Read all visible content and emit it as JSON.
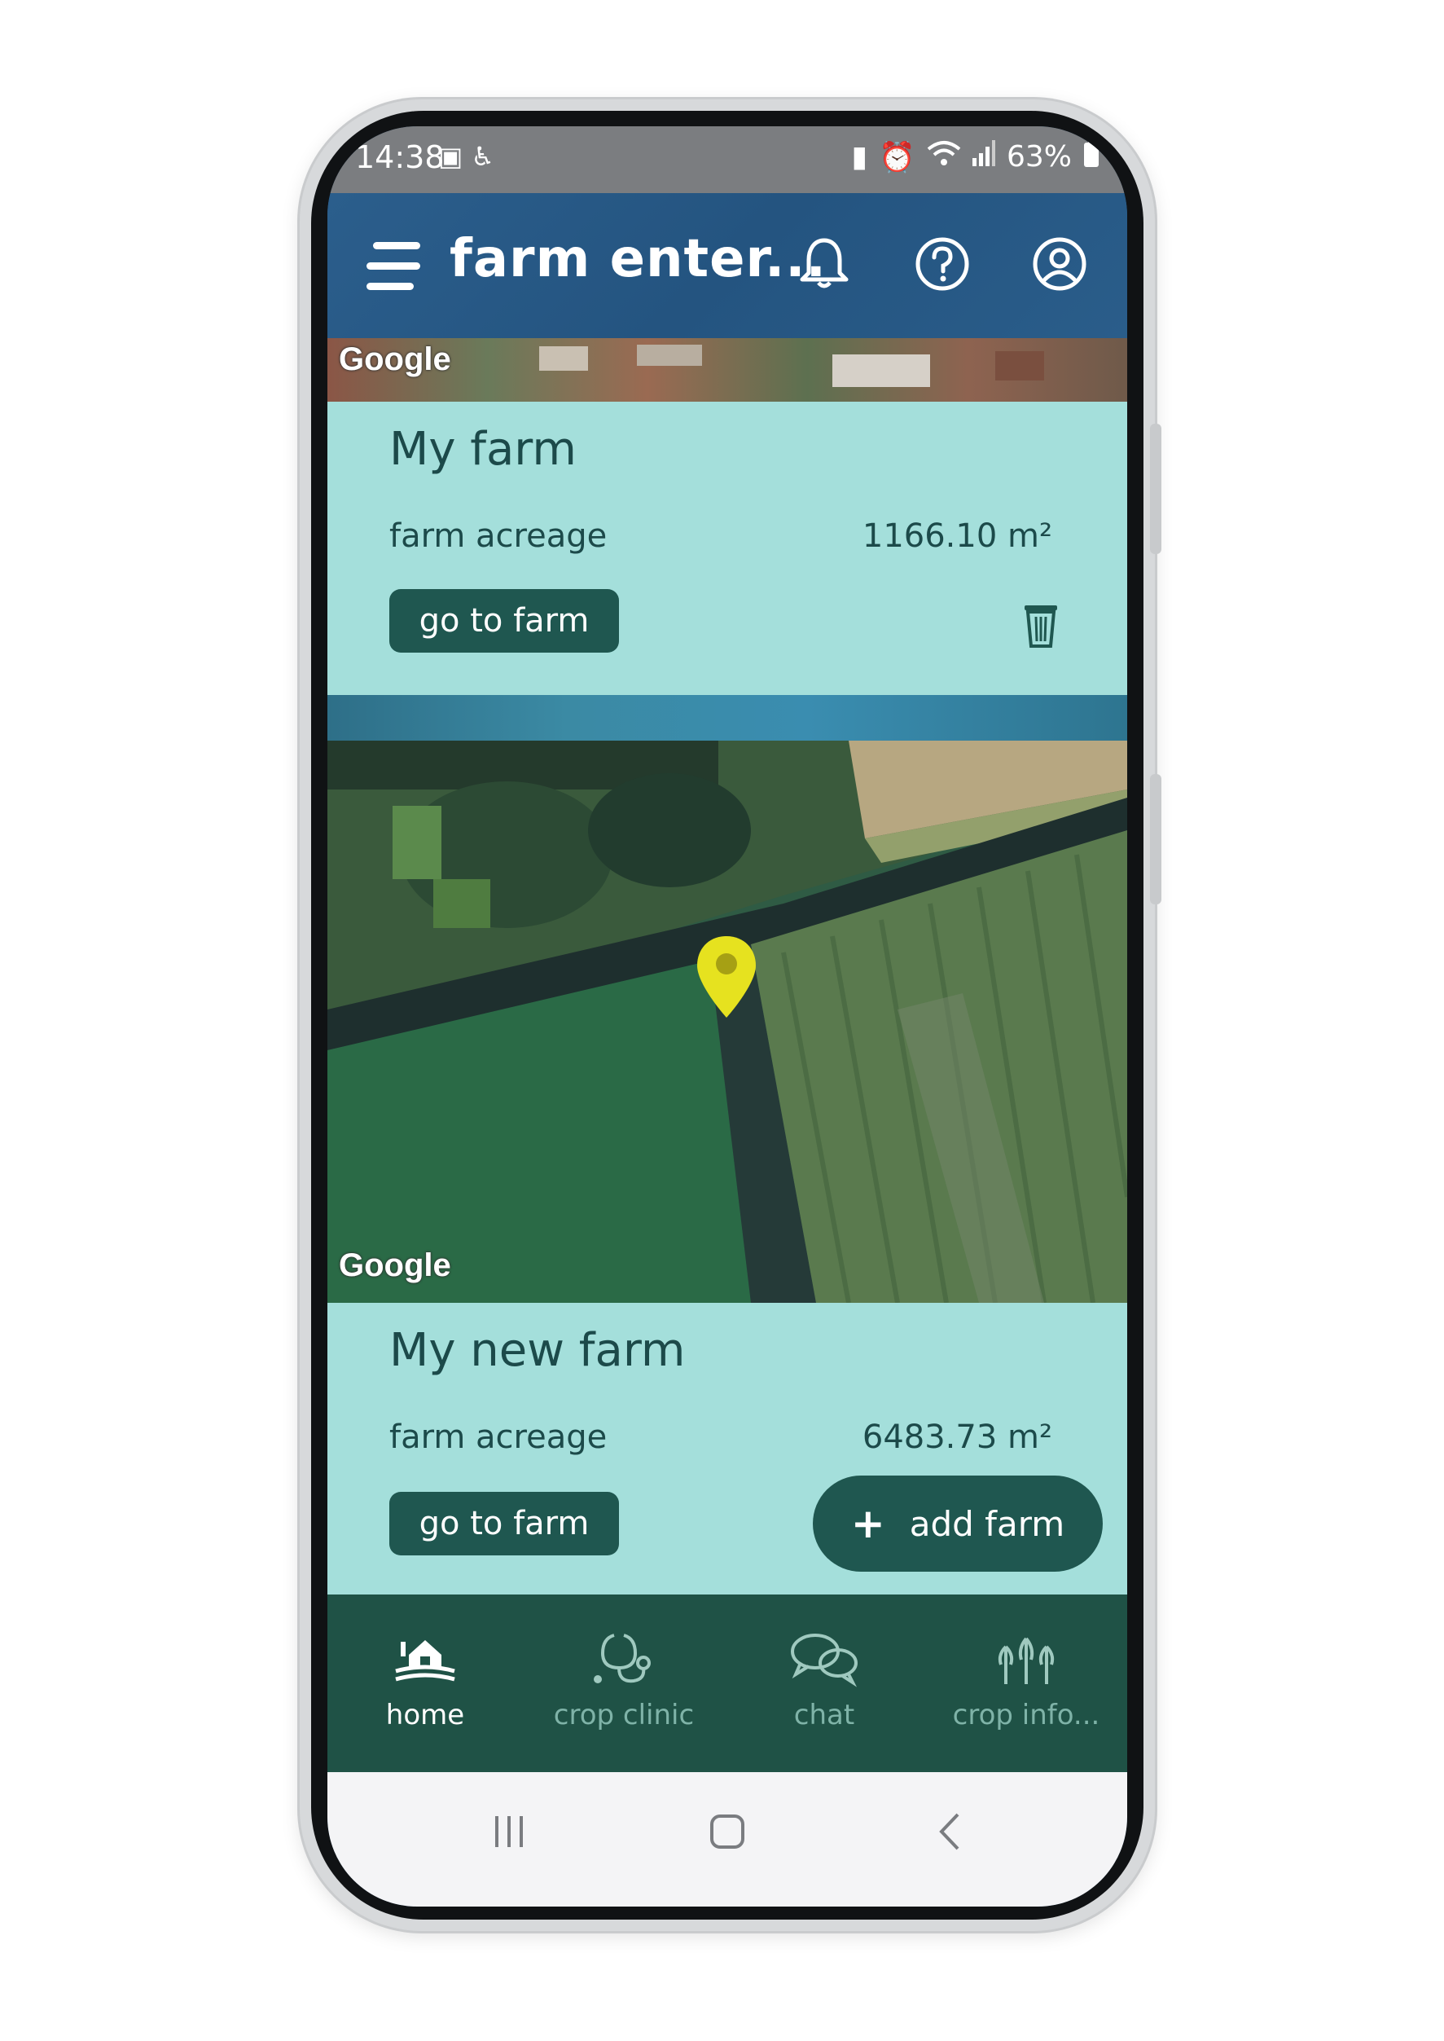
{
  "status_bar": {
    "time": "14:38",
    "battery": "63%",
    "left_icons": [
      "image-icon",
      "accessibility-icon"
    ],
    "right_icons": [
      "battery-saver-icon",
      "alarm-icon",
      "wifi-icon",
      "signal-icon",
      "battery-icon"
    ]
  },
  "app_bar": {
    "title": "farm enter...",
    "icons": [
      "menu-icon",
      "bell-icon",
      "help-icon",
      "account-icon"
    ]
  },
  "map_attribution": "Google",
  "farms": [
    {
      "name": "My farm",
      "acreage_label": "farm acreage",
      "acreage_value": "1166.10 m²",
      "go_label": "go to farm"
    },
    {
      "name": "My new farm",
      "acreage_label": "farm acreage",
      "acreage_value": "6483.73 m²",
      "go_label": "go to farm"
    }
  ],
  "add_farm": {
    "label": "add farm",
    "icon": "plus-icon"
  },
  "bottom_nav": [
    {
      "label": "home",
      "icon": "farm-house-icon",
      "active": true
    },
    {
      "label": "crop clinic",
      "icon": "stethoscope-icon",
      "active": false
    },
    {
      "label": "chat",
      "icon": "chat-bubbles-icon",
      "active": false
    },
    {
      "label": "crop info...",
      "icon": "wheat-icon",
      "active": false
    }
  ],
  "system_nav": [
    "recent-apps-icon",
    "home-icon",
    "back-icon"
  ],
  "colors": {
    "app_bar": "#245480",
    "card": "#a4dfdb",
    "button": "#1f5750",
    "bottom_nav": "#1f5246",
    "pin": "#e6e21f"
  }
}
